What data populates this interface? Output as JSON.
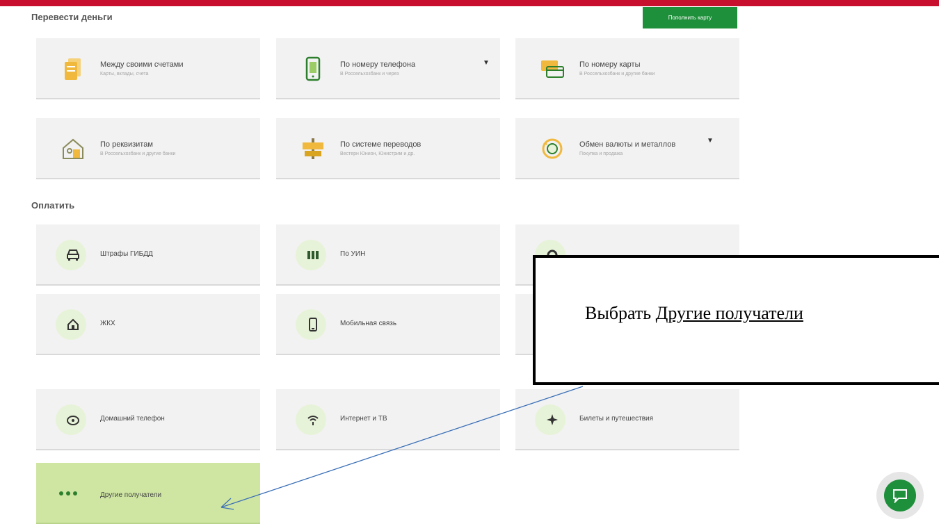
{
  "transfer": {
    "section_title": "Перевести деньги",
    "topup_label": "Пополнить карту",
    "items": [
      {
        "title": "Между своими счетами",
        "sub": "Карты, вклады, счета",
        "icon": "cards-stack-icon"
      },
      {
        "title": "По номеру телефона",
        "sub": "В Россельхозбанк и через",
        "icon": "phone-icon"
      },
      {
        "title": "По номеру карты",
        "sub": "В Россельхозбанк и другие банки",
        "icon": "card-transfer-icon"
      },
      {
        "title": "По реквизитам",
        "sub": "В Россельхозбанк и другие банки",
        "icon": "house-document-icon"
      },
      {
        "title": "По системе переводов",
        "sub": "Вестерн Юнион, Юнистрим и др.",
        "icon": "signpost-icon"
      },
      {
        "title": "Обмен валюты и металлов",
        "sub": "Покупка и продажа",
        "icon": "currency-exchange-icon"
      }
    ]
  },
  "pay": {
    "section_title": "Оплатить",
    "items": [
      {
        "title": "Штрафы ГИБДД",
        "icon": "car-icon"
      },
      {
        "title": "По УИН",
        "icon": "barcode-icon"
      },
      {
        "title": "",
        "icon": "gear-icon"
      },
      {
        "title": "ЖКХ",
        "icon": "house-icon"
      },
      {
        "title": "Мобильная связь",
        "icon": "mobile-icon"
      },
      {
        "title": "",
        "icon": ""
      },
      {
        "title": "Домашний телефон",
        "icon": "home-phone-icon"
      },
      {
        "title": "Интернет и ТВ",
        "icon": "wifi-icon"
      },
      {
        "title": "Билеты и путешествия",
        "icon": "plane-icon"
      }
    ],
    "other_label": "Другие получатели"
  },
  "callout": {
    "prefix": "Выбрать ",
    "link": "Другие получатели"
  },
  "colors": {
    "brand_red": "#c8102e",
    "brand_green": "#1e8f3a",
    "card_bg": "#f2f2f2",
    "icon_bg": "#e7f3d8",
    "highlight": "#cfe6a3",
    "arrow": "#3a6fb7"
  }
}
